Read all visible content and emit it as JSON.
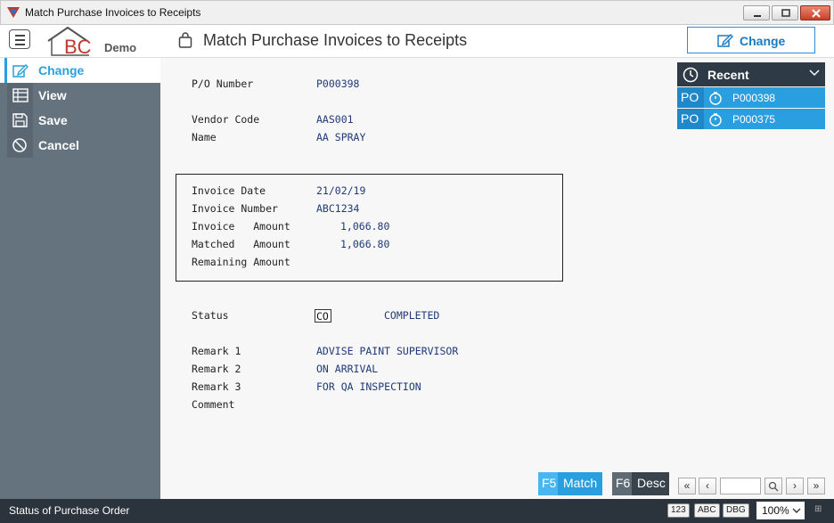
{
  "window": {
    "title": "Match Purchase Invoices to Receipts"
  },
  "header": {
    "logo_text": "BC",
    "logo_suffix": "Demo",
    "page_title": "Match Purchase Invoices to Receipts",
    "change_label": "Change"
  },
  "sidebar": {
    "items": [
      {
        "label": "Change",
        "icon": "edit-icon",
        "active": true
      },
      {
        "label": "View",
        "icon": "table-icon"
      },
      {
        "label": "Save",
        "icon": "save-icon"
      },
      {
        "label": "Cancel",
        "icon": "cancel-icon"
      }
    ]
  },
  "form": {
    "po_number": {
      "label": "P/O Number",
      "value": "P000398"
    },
    "vendor_code": {
      "label": "Vendor Code",
      "value": "AAS001"
    },
    "name": {
      "label": "Name",
      "value": "AA SPRAY"
    },
    "invoice_date": {
      "label": "Invoice Date",
      "value": "21/02/19"
    },
    "invoice_number": {
      "label": "Invoice Number",
      "value": "ABC1234"
    },
    "invoice_amount": {
      "label": "Invoice   Amount",
      "value": "1,066.80"
    },
    "matched_amount": {
      "label": "Matched   Amount",
      "value": "1,066.80"
    },
    "remaining_amount": {
      "label": "Remaining Amount",
      "value": ""
    },
    "status": {
      "label": "Status",
      "code": "CO",
      "text": "COMPLETED"
    },
    "remark1": {
      "label": "Remark 1",
      "value": "ADVISE PAINT SUPERVISOR"
    },
    "remark2": {
      "label": "Remark 2",
      "value": "ON ARRIVAL"
    },
    "remark3": {
      "label": "Remark 3",
      "value": "FOR QA INSPECTION"
    },
    "comment": {
      "label": "Comment",
      "value": ""
    }
  },
  "recent": {
    "title": "Recent",
    "items": [
      {
        "type": "PO",
        "number": "P000398"
      },
      {
        "type": "PO",
        "number": "P000375"
      }
    ]
  },
  "fkeys": {
    "f5": {
      "key": "F5",
      "label": "Match"
    },
    "f6": {
      "key": "F6",
      "label": "Desc"
    }
  },
  "statusbar": {
    "message": "Status of Purchase Order",
    "badges": [
      "123",
      "ABC",
      "DBG"
    ],
    "zoom": "100%"
  },
  "colors": {
    "accent": "#2a9fe0",
    "sidebar": "#65737e",
    "statusbar": "#2b343c"
  }
}
